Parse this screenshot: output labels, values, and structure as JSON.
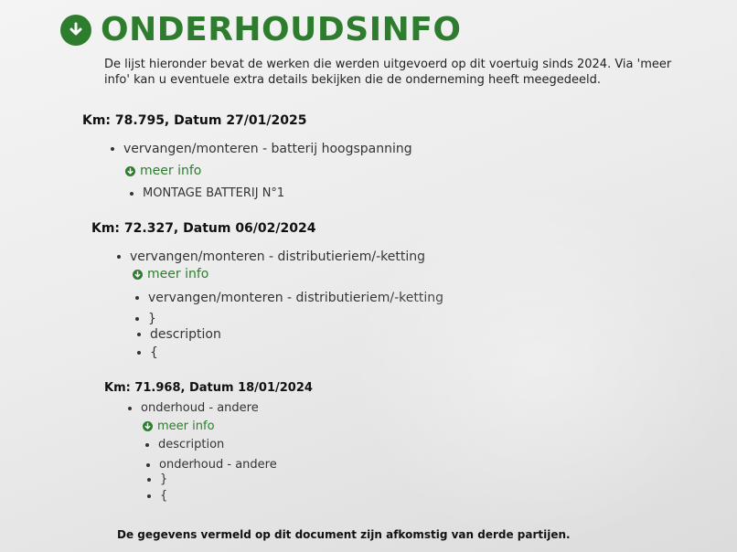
{
  "section": {
    "title": "ONDERHOUDSINFO",
    "icon": "arrow-down-circle-icon",
    "accent_color": "#2e7d2e",
    "intro": "De lijst hieronder bevat de werken die werden uitgevoerd op dit voertuig sinds 2024. Via 'meer info' kan u eventuele extra details bekijken die de onderneming heeft meegedeeld."
  },
  "entries": [
    {
      "header": "Km: 78.795, Datum 27/01/2025",
      "work": "vervangen/monteren - batterij hoogspanning",
      "meer_info_label": "meer info",
      "details": [
        "MONTAGE BATTERIJ N°1"
      ]
    },
    {
      "header": "Km: 72.327, Datum 06/02/2024",
      "work": "vervangen/monteren - distributieriem/-ketting",
      "meer_info_label": "meer info",
      "details": [
        "vervangen/monteren - distributieriem/-ketting",
        "}",
        "description",
        "{"
      ]
    },
    {
      "header": "Km: 71.968, Datum 18/01/2024",
      "work": "onderhoud - andere",
      "meer_info_label": "meer info",
      "details": [
        "description",
        "onderhoud - andere",
        "}",
        "{"
      ]
    }
  ],
  "footer": {
    "text": "De gegevens vermeld op dit document zijn afkomstig van derde partijen."
  }
}
